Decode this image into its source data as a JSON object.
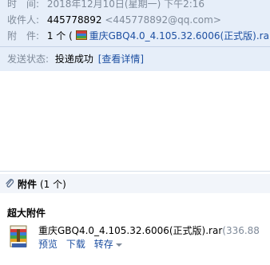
{
  "header": {
    "time_label": "时　间:",
    "time_value": "2018年12月10日(星期一) 下午2:16",
    "sender_label": "收件人:",
    "sender_name": "445778892",
    "sender_email": "<445778892@qq.com>",
    "attach_label": "附　件:",
    "attach_count": "1 个 (",
    "attach_name": "重庆GBQ4.0_4.105.32.6006(正式版).ra"
  },
  "status": {
    "label": "发送状态:",
    "value": "投递成功",
    "detail_link": "[查看详情]"
  },
  "attachments": {
    "title": "附件",
    "count": "(1 个)",
    "big_label": "超大附件",
    "file": {
      "name": "重庆GBQ4.0_4.105.32.6006(正式版).rar",
      "size": "(336.88",
      "actions": [
        "预览",
        "下载",
        "转存"
      ]
    }
  },
  "colors": {
    "header_bg": "#e6eef9",
    "link": "#1e50a2",
    "muted": "#7f8a99"
  }
}
